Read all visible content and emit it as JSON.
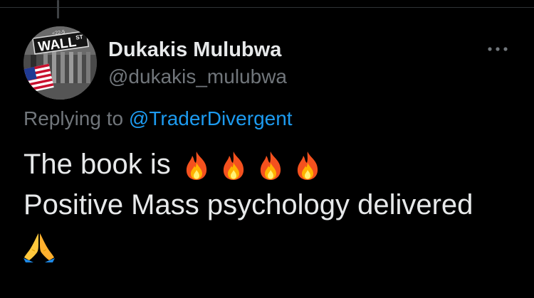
{
  "tweet": {
    "author": {
      "display_name": "Dukakis Mulubwa",
      "handle": "@dukakis_mulubwa",
      "avatar": {
        "icon": "wall-street-sign-avatar",
        "sign_text": "WALL",
        "sign_suffix": "ST",
        "sign_number": "<22-5"
      }
    },
    "more_icon": "ellipsis-icon",
    "replying_to": {
      "prefix": "Replying to",
      "mention": "@TraderDivergent"
    },
    "body": {
      "line1_text": "The book is",
      "line1_emojis": [
        "fire-emoji",
        "fire-emoji",
        "fire-emoji",
        "fire-emoji"
      ],
      "line2_text": "Positive Mass psychology delivered",
      "line3_emojis": [
        "folded-hands-emoji"
      ]
    }
  },
  "colors": {
    "background": "#000000",
    "primary_text": "#e7e9ea",
    "secondary_text": "#71767b",
    "link": "#1d9bf0",
    "divider": "#2f3336"
  }
}
